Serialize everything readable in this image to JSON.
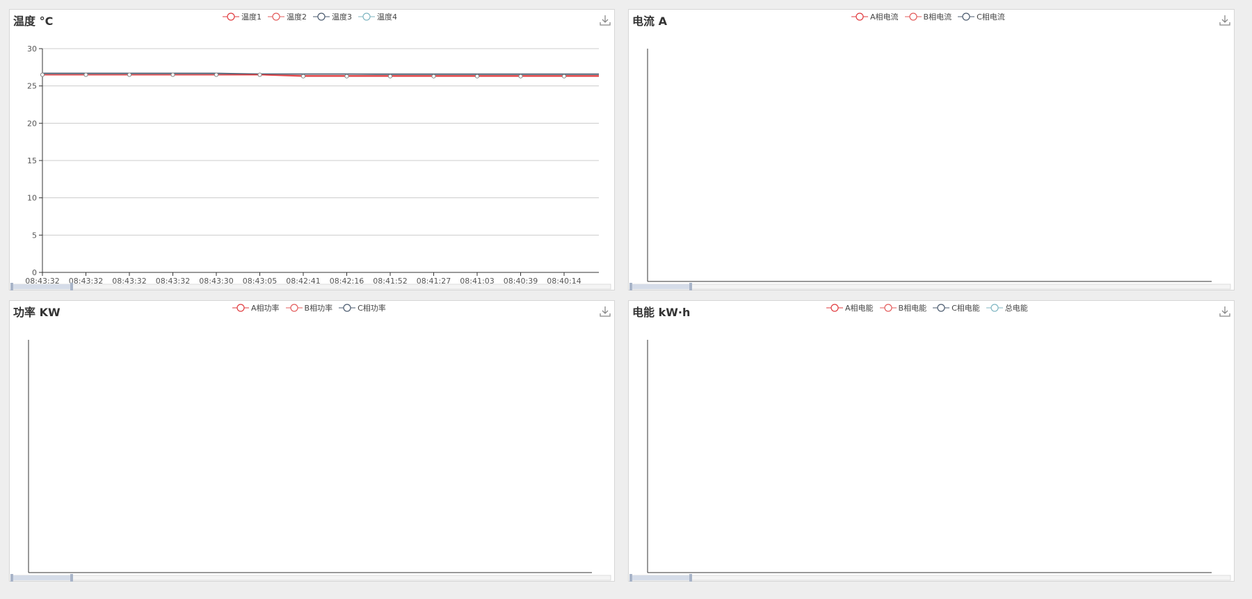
{
  "colors": {
    "series": [
      "#e03a3e",
      "#e35b5b",
      "#4a5a6e",
      "#7fb6c2"
    ],
    "axis": "#333333",
    "grid": "#cccccc"
  },
  "panels": {
    "temperature": {
      "title": "温度 °C",
      "legend": [
        "温度1",
        "温度2",
        "温度3",
        "温度4"
      ],
      "download_icon": "download-icon"
    },
    "current": {
      "title": "电流 A",
      "legend": [
        "A相电流",
        "B相电流",
        "C相电流"
      ],
      "download_icon": "download-icon"
    },
    "power": {
      "title": "功率 KW",
      "legend": [
        "A相功率",
        "B相功率",
        "C相功率"
      ],
      "download_icon": "download-icon"
    },
    "energy": {
      "title": "电能 kW·h",
      "legend": [
        "A相电能",
        "B相电能",
        "C相电能",
        "总电能"
      ],
      "download_icon": "download-icon"
    }
  },
  "chart_data": [
    {
      "type": "line",
      "title": "温度 °C",
      "x": [
        "08:43:32",
        "08:43:32",
        "08:43:32",
        "08:43:32",
        "08:43:30",
        "08:43:05",
        "08:42:41",
        "08:42:16",
        "08:41:52",
        "08:41:27",
        "08:41:03",
        "08:40:39",
        "08:40:14"
      ],
      "ylim": [
        0,
        30
      ],
      "yticks": [
        0,
        5,
        10,
        15,
        20,
        25,
        30
      ],
      "grid": true,
      "legend_position": "top-center",
      "series": [
        {
          "name": "温度1",
          "values": [
            26.5,
            26.5,
            26.5,
            26.5,
            26.5,
            26.5,
            26.3,
            26.3,
            26.3,
            26.3,
            26.3,
            26.3,
            26.3
          ]
        },
        {
          "name": "温度2",
          "values": [
            26.5,
            26.5,
            26.5,
            26.5,
            26.5,
            26.5,
            26.4,
            26.4,
            26.4,
            26.4,
            26.4,
            26.4,
            26.4
          ]
        },
        {
          "name": "温度3",
          "values": [
            26.7,
            26.7,
            26.7,
            26.7,
            26.7,
            26.6,
            26.6,
            26.6,
            26.6,
            26.6,
            26.6,
            26.6,
            26.6
          ]
        },
        {
          "name": "温度4",
          "values": [
            26.6,
            26.6,
            26.6,
            26.6,
            26.6,
            26.6,
            26.6,
            26.6,
            26.5,
            26.5,
            26.5,
            26.5,
            26.5
          ]
        }
      ]
    },
    {
      "type": "line",
      "title": "电流 A",
      "x": [],
      "legend_position": "top-center",
      "series": [
        {
          "name": "A相电流",
          "values": []
        },
        {
          "name": "B相电流",
          "values": []
        },
        {
          "name": "C相电流",
          "values": []
        }
      ]
    },
    {
      "type": "line",
      "title": "功率 KW",
      "x": [],
      "legend_position": "top-center",
      "series": [
        {
          "name": "A相功率",
          "values": []
        },
        {
          "name": "B相功率",
          "values": []
        },
        {
          "name": "C相功率",
          "values": []
        }
      ]
    },
    {
      "type": "line",
      "title": "电能 kW·h",
      "x": [],
      "legend_position": "top-center",
      "series": [
        {
          "name": "A相电能",
          "values": []
        },
        {
          "name": "B相电能",
          "values": []
        },
        {
          "name": "C相电能",
          "values": []
        },
        {
          "name": "总电能",
          "values": []
        }
      ]
    }
  ]
}
